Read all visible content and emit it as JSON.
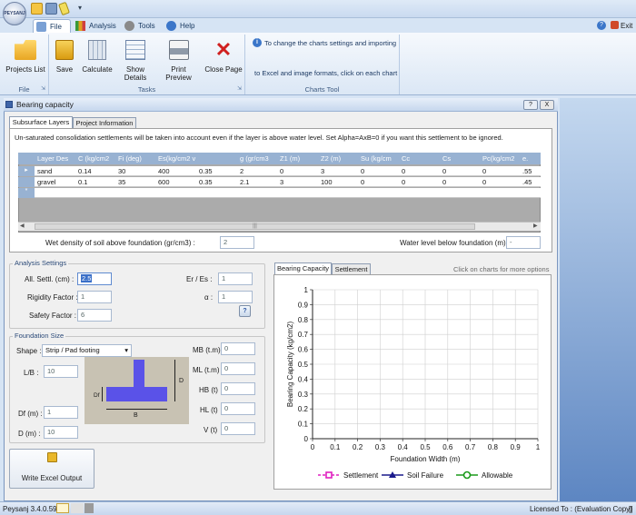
{
  "app": {
    "logo_text": "PEYSANJ",
    "exit_label": "Exit",
    "help_label": "?"
  },
  "ribbon_tabs": [
    {
      "label": "File"
    },
    {
      "label": "Analysis"
    },
    {
      "label": "Tools"
    },
    {
      "label": "Help"
    }
  ],
  "ribbon": {
    "projects_list": "Projects List",
    "save": "Save",
    "calculate": "Calculate",
    "show_details": "Show Details",
    "print_preview": "Print Preview",
    "close_page": "Close Page",
    "group_file": "File",
    "group_tasks": "Tasks",
    "group_charts": "Charts Tool",
    "charts_info_1": "To change the charts settings and importing",
    "charts_info_2": "to Excel and image formats, click on each chart"
  },
  "window": {
    "title": "Bearing capacity",
    "help_btn": "?",
    "close_btn": "X"
  },
  "top_tabs": [
    "Subsurface Layers",
    "Project Information"
  ],
  "notice": "Un-saturated consolidation settlements will be taken into account even if the layer is above water level. Set Alpha=AxB=0 if you want this settlement to be ignored.",
  "grid": {
    "columns": [
      "Layer Des",
      "C (kg/cm2",
      "Fi (deg)",
      "Es(kg/cm2 v",
      "g (gr/cm3",
      "Z1 (m)",
      "Z2 (m)",
      "Su (kg/cm",
      "Cc",
      "Cs",
      "Pc(kg/cm2",
      "e."
    ],
    "rows": [
      [
        "sand",
        "0.14",
        "30",
        "400",
        "0.35",
        "2",
        "0",
        "3",
        "0",
        "0",
        "0",
        "0",
        ".55"
      ],
      [
        "gravel",
        "0.1",
        "35",
        "600",
        "0.35",
        "2.1",
        "3",
        "100",
        "0",
        "0",
        "0",
        "0",
        ".45"
      ]
    ],
    "new_row_marker": "*",
    "current_row_marker": "▸",
    "scroll_grip": "|||"
  },
  "wet_density": {
    "label": "Wet density of soil above foundation (gr/cm3) :",
    "value": "2"
  },
  "water_level": {
    "label": "Water level below foundation (m) :",
    "value": "-"
  },
  "analysis": {
    "legend": "Analysis Settings",
    "all_settl_label": "All. Settl. (cm) :",
    "all_settl_value": "2.5",
    "rigidity_label": "Rigidity Factor :",
    "rigidity_value": "1",
    "safety_label": "Safety Factor :",
    "safety_value": "6",
    "er_es_label": "Er / Es :",
    "er_es_value": "1",
    "alpha_label": "α :",
    "alpha_value": "1",
    "calc_icon_label": "?"
  },
  "foundation": {
    "legend": "Foundation Size",
    "shape_label": "Shape :",
    "shape_value": "Strip / Pad footing",
    "lb_label": "L/B :",
    "lb_value": "10",
    "df_label": "Df (m) :",
    "df_value": "1",
    "d_label": "D (m) :",
    "d_value": "10",
    "diagram_df": "Df",
    "diagram_d": "D",
    "diagram_b": "B",
    "mb_label": "MB (t.m)",
    "mb_value": "0",
    "ml_label": "ML (t.m)",
    "ml_value": "0",
    "hb_label": "HB (t)",
    "hb_value": "0",
    "hl_label": "HL (t)",
    "hl_value": "0",
    "v_label": "V (t)",
    "v_value": "0"
  },
  "write_excel": "Write Excel Output",
  "chart_tabs": [
    "Bearing Capacity",
    "Settlement"
  ],
  "chart_hint": "Click on charts for more options",
  "chart_data": {
    "type": "line",
    "xlabel": "Foundation Width (m)",
    "ylabel": "Bearing Capacity (kg/cm2)",
    "xlim": [
      0,
      1
    ],
    "ylim": [
      0,
      1
    ],
    "xticks": [
      "0",
      "0.1",
      "0.2",
      "0.3",
      "0.4",
      "0.5",
      "0.6",
      "0.7",
      "0.8",
      "0.9",
      "1"
    ],
    "yticks": [
      "0",
      "0.1",
      "0.2",
      "0.3",
      "0.4",
      "0.5",
      "0.6",
      "0.7",
      "0.8",
      "0.9",
      "1"
    ],
    "grid": true,
    "legend_position": "bottom",
    "series": [
      {
        "name": "Settlement",
        "color": "#e020c0",
        "values": []
      },
      {
        "name": "Soil Failure",
        "color": "#1a1a8c",
        "values": []
      },
      {
        "name": "Allowable",
        "color": "#1a9a1a",
        "values": []
      }
    ]
  },
  "status": {
    "version": "Peysanj 3.4.0.59",
    "license": "Licensed To : (Evaluation Copy)",
    "trail": "[]"
  },
  "colors": {
    "accent": "#98b2d2",
    "footing": "#5a52e8"
  }
}
